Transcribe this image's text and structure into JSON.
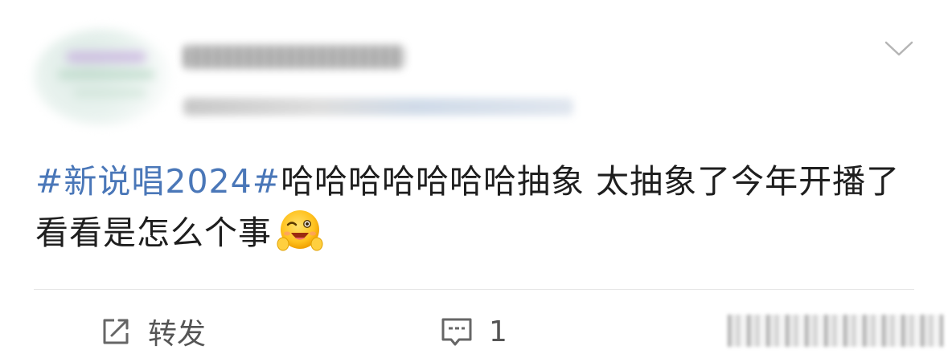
{
  "post": {
    "hashtag": "#新说唱2024#",
    "text": "哈哈哈哈哈哈哈抽象 太抽象了今年开播了看看是怎么个事",
    "emoji": "wink-face-emoji"
  },
  "header": {
    "menu_icon": "chevron-down-icon"
  },
  "actions": {
    "repost_label": "转发",
    "comment_count": "1",
    "repost_icon": "share-icon",
    "comment_icon": "comment-icon"
  },
  "colors": {
    "hashtag": "#4a77b8",
    "text": "#1e1e1e",
    "action_text": "#555555",
    "divider": "#e6e6e6"
  }
}
